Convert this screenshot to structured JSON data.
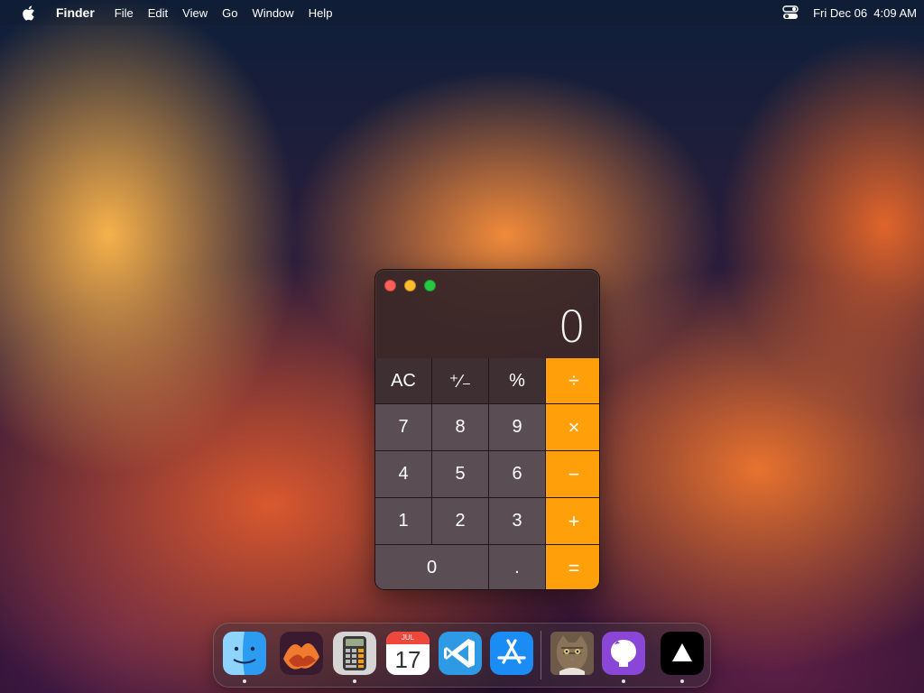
{
  "menubar": {
    "app_name": "Finder",
    "items": [
      "File",
      "Edit",
      "View",
      "Go",
      "Window",
      "Help"
    ],
    "datetime": "Fri Dec 06  4:09 AM"
  },
  "calculator": {
    "display": "0",
    "rows": [
      [
        {
          "label": "AC",
          "kind": "fn",
          "name": "all-clear-button"
        },
        {
          "label": "⁺∕₋",
          "kind": "fn",
          "name": "sign-toggle-button"
        },
        {
          "label": "%",
          "kind": "fn",
          "name": "percent-button"
        },
        {
          "label": "÷",
          "kind": "op",
          "name": "divide-button"
        }
      ],
      [
        {
          "label": "7",
          "kind": "num",
          "name": "digit-7-button"
        },
        {
          "label": "8",
          "kind": "num",
          "name": "digit-8-button"
        },
        {
          "label": "9",
          "kind": "num",
          "name": "digit-9-button"
        },
        {
          "label": "×",
          "kind": "op",
          "name": "multiply-button"
        }
      ],
      [
        {
          "label": "4",
          "kind": "num",
          "name": "digit-4-button"
        },
        {
          "label": "5",
          "kind": "num",
          "name": "digit-5-button"
        },
        {
          "label": "6",
          "kind": "num",
          "name": "digit-6-button"
        },
        {
          "label": "−",
          "kind": "op",
          "name": "subtract-button"
        }
      ],
      [
        {
          "label": "1",
          "kind": "num",
          "name": "digit-1-button"
        },
        {
          "label": "2",
          "kind": "num",
          "name": "digit-2-button"
        },
        {
          "label": "3",
          "kind": "num",
          "name": "digit-3-button"
        },
        {
          "label": "+",
          "kind": "op",
          "name": "add-button"
        }
      ],
      [
        {
          "label": "0",
          "kind": "zero",
          "name": "digit-0-button"
        },
        {
          "label": ".",
          "kind": "num",
          "name": "decimal-button"
        },
        {
          "label": "=",
          "kind": "op",
          "name": "equals-button"
        }
      ]
    ]
  },
  "dock": {
    "calendar_month": "JUL",
    "calendar_day": "17",
    "apps": [
      {
        "name": "finder",
        "icon": "finder-icon",
        "running": true
      },
      {
        "name": "macos-wallpaper",
        "icon": "wallpaper-icon",
        "running": false
      },
      {
        "name": "calculator",
        "icon": "calculator-icon",
        "running": true
      },
      {
        "name": "calendar",
        "icon": "calendar-icon",
        "running": false
      },
      {
        "name": "vscode",
        "icon": "vscode-icon",
        "running": false
      },
      {
        "name": "app-store",
        "icon": "app-store-icon",
        "running": false
      },
      {
        "name": "cat-photo",
        "icon": "cat-icon",
        "running": false
      },
      {
        "name": "github-desktop",
        "icon": "github-icon",
        "running": true
      },
      {
        "name": "vercel",
        "icon": "triangle-icon",
        "running": true
      }
    ]
  },
  "colors": {
    "operator": "#ff9f0a",
    "number_key": "#5a4e54",
    "function_key": "#3e2f32"
  }
}
